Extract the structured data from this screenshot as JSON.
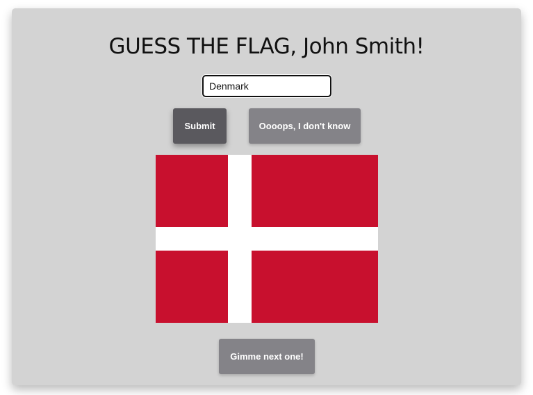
{
  "title": "GUESS THE FLAG, John Smith!",
  "guess": {
    "value": "Denmark",
    "placeholder": ""
  },
  "buttons": {
    "submit_label": "Submit",
    "dont_know_label": "Oooops, I don't know",
    "next_label": "Gimme next one!"
  },
  "flag": {
    "country": "Denmark",
    "field_color": "#c8102e",
    "cross_color": "#ffffff"
  },
  "colors": {
    "card_background": "#d3d3d3",
    "submit_button": "#5a595e",
    "secondary_button": "#848388"
  }
}
